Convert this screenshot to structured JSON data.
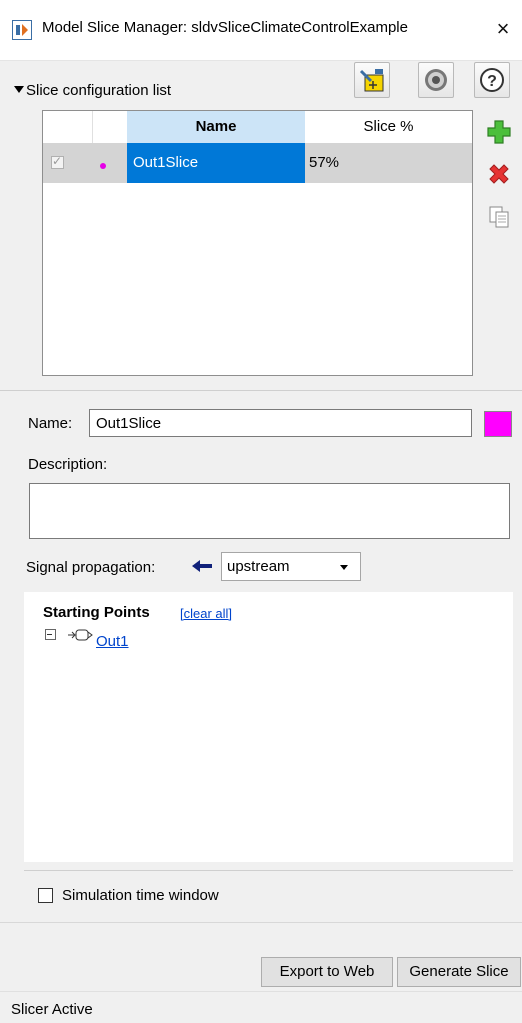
{
  "window": {
    "title": "Model Slice Manager: sldvSliceClimateControlExample",
    "close_glyph": "×"
  },
  "toolbar": {
    "icons": [
      "slice-highlight-icon",
      "gear-icon",
      "help-icon"
    ],
    "help_glyph": "?"
  },
  "section": {
    "title": "Slice configuration list"
  },
  "table": {
    "columns": [
      "Name",
      "Slice %"
    ],
    "rows": [
      {
        "checked": true,
        "color": "#e600e6",
        "name": "Out1Slice",
        "slice_pct": "57%"
      }
    ]
  },
  "side_buttons": [
    "add-icon",
    "delete-icon",
    "copy-icon"
  ],
  "form": {
    "name_label": "Name:",
    "name_value": "Out1Slice",
    "highlight_color": "#ff00ff",
    "description_label": "Description:",
    "description_value": "",
    "signal_propagation_label": "Signal propagation:",
    "signal_propagation_value": "upstream"
  },
  "starting_points": {
    "title": "Starting Points",
    "clear_link": "[clear all]",
    "items": [
      {
        "label": "Out1"
      }
    ]
  },
  "options": {
    "simulation_time_window_label": "Simulation time window",
    "simulation_time_window_checked": false
  },
  "actions": {
    "export_label": "Export to Web",
    "generate_label": "Generate Slice"
  },
  "status": {
    "text": "Slicer Active"
  },
  "colors": {
    "selection_blue": "#0078d7",
    "header_blue": "#cce4f7",
    "link_blue": "#0044cc",
    "magenta": "#ff00ff"
  }
}
